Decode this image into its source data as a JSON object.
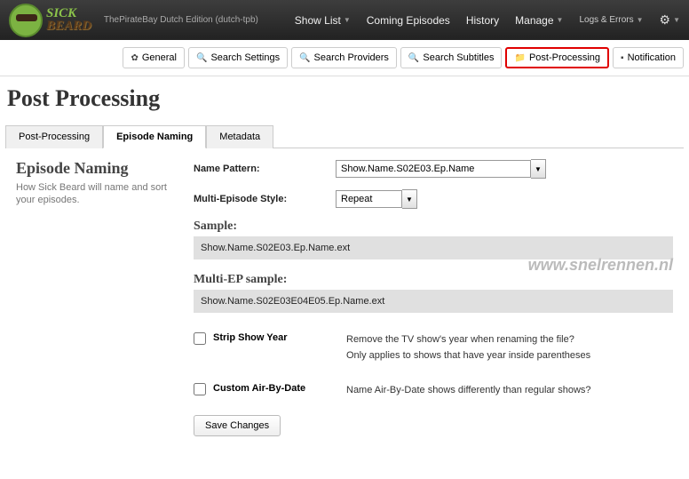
{
  "header": {
    "logo_top": "SICK",
    "logo_bottom": "BEARD",
    "edition": "ThePirateBay Dutch Edition (dutch-tpb)",
    "nav": {
      "show_list": "Show List",
      "coming": "Coming Episodes",
      "history": "History",
      "manage": "Manage",
      "logs": "Logs & Errors"
    }
  },
  "toolbar": {
    "general": "General",
    "search_settings": "Search Settings",
    "search_providers": "Search Providers",
    "search_subtitles": "Search Subtitles",
    "post_processing": "Post-Processing",
    "notification": "Notification"
  },
  "page_title": "Post Processing",
  "tabs": {
    "post_processing": "Post-Processing",
    "episode_naming": "Episode Naming",
    "metadata": "Metadata"
  },
  "section": {
    "title": "Episode Naming",
    "desc": "How Sick Beard will name and sort your episodes."
  },
  "form": {
    "name_pattern_label": "Name Pattern:",
    "name_pattern_value": "Show.Name.S02E03.Ep.Name",
    "multi_ep_label": "Multi-Episode Style:",
    "multi_ep_value": "Repeat",
    "sample_label": "Sample:",
    "sample_value": "Show.Name.S02E03.Ep.Name.ext",
    "multi_sample_label": "Multi-EP sample:",
    "multi_sample_value": "Show.Name.S02E03E04E05.Ep.Name.ext",
    "strip_year_label": "Strip Show Year",
    "strip_year_desc1": "Remove the TV show's year when renaming the file?",
    "strip_year_desc2": "Only applies to shows that have year inside parentheses",
    "custom_abd_label": "Custom Air-By-Date",
    "custom_abd_desc": "Name Air-By-Date shows differently than regular shows?",
    "save": "Save Changes"
  },
  "watermark": "www.snelrennen.nl"
}
